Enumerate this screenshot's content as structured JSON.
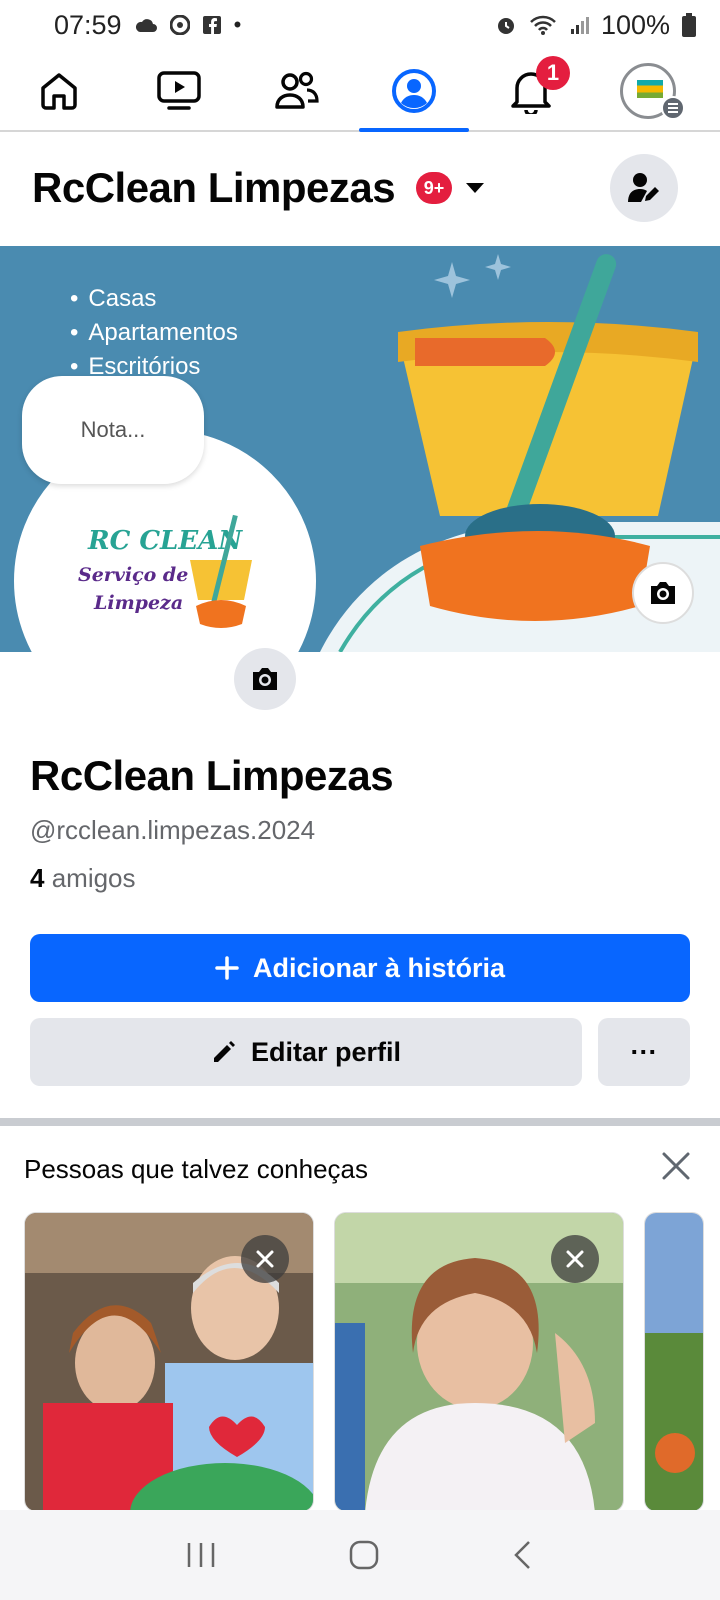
{
  "status_bar": {
    "time": "07:59",
    "battery": "100%"
  },
  "nav": {
    "notifications_badge": "1",
    "tabs": [
      "home",
      "video",
      "friends",
      "profile",
      "notifications",
      "menu"
    ]
  },
  "header": {
    "title": "RcClean Limpezas",
    "badge": "9+"
  },
  "cover": {
    "items": [
      "Casas",
      "Apartamentos",
      "Escritórios"
    ]
  },
  "note": {
    "placeholder": "Nota..."
  },
  "profile_logo": {
    "line1": "RC CLEAN",
    "line2": "Serviço de",
    "line3": "Limpeza"
  },
  "profile": {
    "name": "RcClean Limpezas",
    "handle": "@rcclean.limpezas.2024",
    "friends_count": "4",
    "friends_label": "amigos"
  },
  "actions": {
    "add_story": "Adicionar à história",
    "edit_profile": "Editar perfil",
    "more": "···"
  },
  "pymk": {
    "title": "Pessoas que talvez conheças"
  },
  "colors": {
    "accent": "#0866ff",
    "badge": "#e41e3f",
    "cover": "#4a8bb0"
  }
}
